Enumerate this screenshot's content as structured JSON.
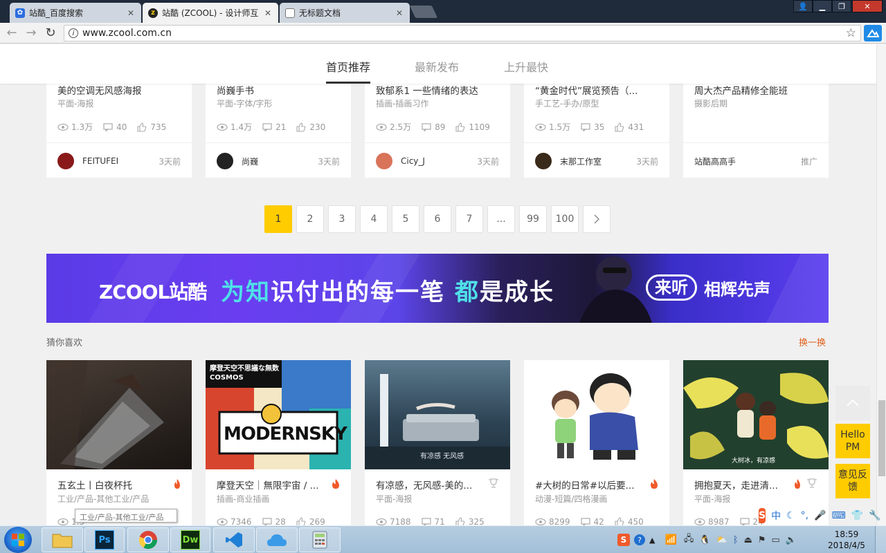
{
  "browser": {
    "tabs": [
      {
        "label": "站酷_百度搜索",
        "icon": "baidu-paw"
      },
      {
        "label": "站酷 (ZCOOL) - 设计师互",
        "icon": "zcool-z"
      },
      {
        "label": "无标题文档",
        "icon": "document"
      }
    ],
    "url": "www.zcool.com.cn"
  },
  "subnav": {
    "items": [
      "首页推荐",
      "最新发布",
      "上升最快"
    ]
  },
  "top_cards": [
    {
      "title": "美的空调无风感海报",
      "category": "平面-海报",
      "views": "1.3万",
      "comments": "40",
      "likes": "735",
      "author": "FEITUFEI",
      "time": "3天前",
      "avatar_color": "#8a1a1a"
    },
    {
      "title": "尚巍手书",
      "category": "平面-字体/字形",
      "views": "1.4万",
      "comments": "21",
      "likes": "230",
      "author": "尚巍",
      "time": "3天前",
      "avatar_color": "#222222"
    },
    {
      "title": "致郁系1 一些情绪的表达",
      "category": "插画-插画习作",
      "views": "2.5万",
      "comments": "89",
      "likes": "1109",
      "author": "Cicy_J",
      "time": "3天前",
      "avatar_color": "#d9735a"
    },
    {
      "title": "“黄金时代”展览预告（...",
      "category": "手工艺-手办/原型",
      "views": "1.5万",
      "comments": "35",
      "likes": "431",
      "author": "末那工作室",
      "time": "3天前",
      "avatar_color": "#3a2a1a"
    },
    {
      "title": "周大杰产品精修全能班",
      "category": "摄影后期",
      "views": "",
      "comments": "",
      "likes": "",
      "author": "站酷高高手",
      "time": "推广",
      "avatar_color": ""
    }
  ],
  "pagination": [
    "1",
    "2",
    "3",
    "4",
    "5",
    "6",
    "7",
    "...",
    "99",
    "100"
  ],
  "banner": {
    "logo": "ZCOOL站酷",
    "slogan_a": "为知",
    "slogan_b": "识付出的每一笔 ",
    "slogan_c": "都",
    "slogan_d": "是成长",
    "listen": "来听",
    "tagline": "相辉先声"
  },
  "section": {
    "title": "猜你喜欢",
    "refresh": "换一换"
  },
  "recommend_cards": [
    {
      "title": "五玄土丨白夜杯托",
      "category": "工业/产品-其他工业/产品",
      "views": "1.5",
      "comments": "",
      "likes": "",
      "hot": true,
      "award": false
    },
    {
      "title": "摩登天空｜無限宇宙 / ...",
      "category": "插画-商业插画",
      "views": "7346",
      "comments": "28",
      "likes": "269",
      "hot": true,
      "award": false,
      "thumb_text": "摩登天空不思議な無数COSMOS",
      "thumb_big": "MODERNSKY"
    },
    {
      "title": "有凉感，无风感-美的...",
      "category": "平面-海报",
      "views": "7188",
      "comments": "71",
      "likes": "325",
      "hot": false,
      "award": true,
      "thumb_text": "有凉感 无风感"
    },
    {
      "title": "#大树的日常#以后要...",
      "category": "动漫-短篇/四格漫画",
      "views": "8299",
      "comments": "42",
      "likes": "450",
      "hot": true,
      "award": false
    },
    {
      "title": "拥抱夏天，走进清...",
      "category": "平面-海报",
      "views": "8987",
      "comments": "24",
      "likes": "",
      "hot": true,
      "award": true,
      "thumb_text": "大树冰，有凉感"
    }
  ],
  "tooltip": "工业/产品-其他工业/产品",
  "float_buttons": {
    "hello": "Hello PM",
    "feedback": "意见反馈"
  },
  "ime": {
    "lang": "中"
  },
  "taskbar": {
    "time": "18:59",
    "date": "2018/4/5"
  },
  "colors": {
    "accent": "#ffcc00",
    "link": "#e0601c",
    "hot": "#f05a2a"
  }
}
